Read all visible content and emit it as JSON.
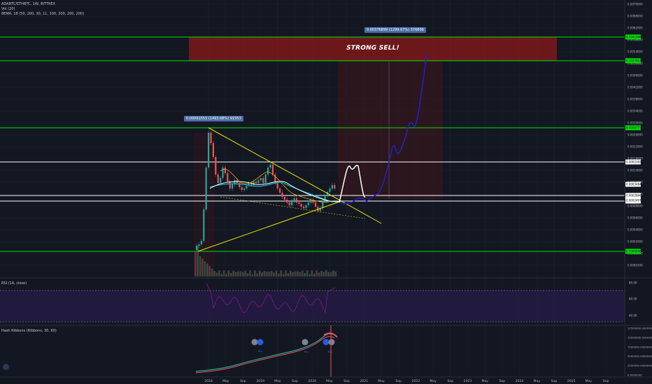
{
  "header": {
    "pair": "ADABTC/ETHBTC, 1W, BITTREX",
    "vol": "Vol (20)",
    "ema": "8EMA, 18 (50, 200, 30, 11, 100, 200, 200, 200)",
    "rsi": "RSI (14, close)",
    "hash": "Hash Ribbons (Ribbons, 30, 60)"
  },
  "annotations": {
    "strong_sell": "STRONG SELL!",
    "measure_top": "0.00376899 (1299.07%) 376899",
    "measure_mid": "0.00091553 (1493.68%) 91553",
    "buy_label": "Buy"
  },
  "colors": {
    "background": "#131722",
    "support_line": "#00e600",
    "white_line": "#ffffff",
    "triangle": "#e6e600",
    "projection_white": "#ffffff",
    "projection_blue": "#2121c8",
    "sell_zone": "#8b1a1a",
    "rsi_band": "#2a1b4a",
    "rsi_line": "#7a1c8a",
    "hash_green": "#26a69a",
    "hash_red": "#ef5350"
  },
  "chart_data": [
    {
      "type": "line",
      "title": "ADABTC/ETHBTC, 1W, BITTREX",
      "x_ticks": [
        "2018",
        "May",
        "Sep",
        "2019",
        "May",
        "Sep",
        "2020",
        "May",
        "Sep",
        "2021",
        "May",
        "Sep",
        "2022",
        "May",
        "Sep",
        "2023",
        "May",
        "Sep",
        "2024",
        "May",
        "Sep",
        "2025",
        "May",
        "Sep",
        "20"
      ],
      "y_ticks": [
        "0.0070000",
        "0.0066000",
        "0.0062000",
        "0.0058000",
        "0.0054000",
        "0.0050000",
        "0.0046000",
        "0.0042000",
        "0.0038000",
        "0.0034000",
        "0.0030000",
        "0.0026000",
        "0.0022000",
        "0.0018000",
        "0.0014000",
        "0.0012000",
        "0.0010000",
        "0.0008000",
        "0.0006000",
        "0.0004000",
        "0.0002000",
        "0.0001000",
        "0.0000300"
      ],
      "price_labels": [
        {
          "text": "0.0041066",
          "color": "#00e600"
        },
        {
          "text": "0.0037663",
          "color": "#00e600"
        },
        {
          "text": "0.0008771",
          "color": "#00e600"
        },
        {
          "text": "0.0005392",
          "color": "#ffffff"
        },
        {
          "text": "0.0003484",
          "color": "#ffffff"
        },
        {
          "text": "0.0002866",
          "color": "#ffffff"
        },
        {
          "text": "0.0002447",
          "color": "#ffffff"
        },
        {
          "text": "0.0002497",
          "color": "#ffffff"
        },
        {
          "text": "0.0000948",
          "color": "#00e600"
        }
      ],
      "levels": {
        "green": [
          0.0041066,
          0.0037663,
          0.0008771,
          9.48e-05
        ],
        "white": [
          0.0005392,
          0.0002866,
          0.0002447
        ]
      },
      "log_scale": true
    },
    {
      "type": "line",
      "title": "RSI (14, close)",
      "y_ticks": [
        "80.00",
        "60.00",
        "40.00"
      ],
      "band": [
        30,
        70
      ]
    },
    {
      "type": "line",
      "title": "Hash Ribbons (Ribbons, 30, 60)",
      "y_ticks": [
        "12500000.0000000",
        "10000000.0000000",
        "7500000.0000000",
        "5000000.0000000",
        "2500000.0000000",
        "0.0000000"
      ]
    }
  ]
}
